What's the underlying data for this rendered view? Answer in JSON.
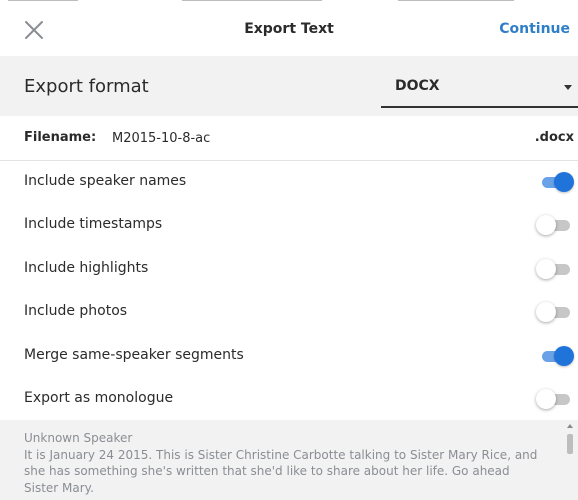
{
  "header": {
    "title": "Export Text",
    "continue_label": "Continue"
  },
  "export_format": {
    "label": "Export format",
    "selected": "DOCX"
  },
  "filename": {
    "label": "Filename:",
    "value": "M2015-10-8-ac",
    "extension": ".docx"
  },
  "options": [
    {
      "label": "Include speaker names",
      "enabled": true
    },
    {
      "label": "Include timestamps",
      "enabled": false
    },
    {
      "label": "Include highlights",
      "enabled": false
    },
    {
      "label": "Include photos",
      "enabled": false
    },
    {
      "label": "Merge same-speaker segments",
      "enabled": true
    },
    {
      "label": "Export as monologue",
      "enabled": false
    }
  ],
  "preview": {
    "speaker": "Unknown Speaker",
    "text": "It is January 24 2015. This is Sister Christine Carbotte talking to Sister Mary Rice, and she has something she's written that she'd like to share about her life. Go ahead Sister Mary."
  },
  "colors": {
    "accent": "#2f7fc8",
    "toggle_on": "#1f73d9",
    "toggle_off": "#c7c7c7"
  }
}
